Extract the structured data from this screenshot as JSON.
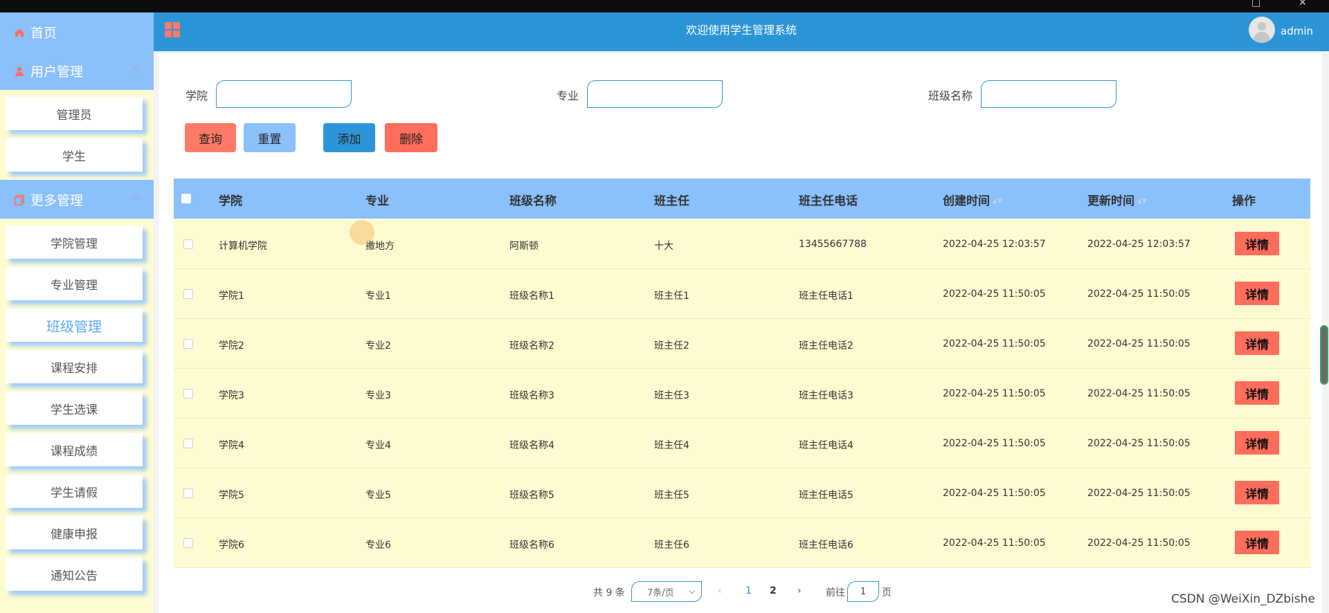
{
  "sidebar": {
    "home_label": "首页",
    "user_mgmt_label": "用户管理",
    "user_items": [
      "管理员",
      "学生"
    ],
    "more_mgmt_label": "更多管理",
    "more_items": [
      "学院管理",
      "专业管理",
      "班级管理",
      "课程安排",
      "学生选课",
      "课程成绩",
      "学生请假",
      "健康申报",
      "通知公告"
    ],
    "active_item": "班级管理"
  },
  "header": {
    "title": "欢迎使用学生管理系统",
    "username": "admin"
  },
  "filters": {
    "college_label": "学院",
    "college_value": "",
    "major_label": "专业",
    "major_value": "",
    "class_label": "班级名称",
    "class_value": ""
  },
  "actions": {
    "search": "查询",
    "reset": "重置",
    "add": "添加",
    "delete": "删除"
  },
  "table": {
    "columns": [
      "学院",
      "专业",
      "班级名称",
      "班主任",
      "班主任电话",
      "创建时间",
      "更新时间",
      "操作"
    ],
    "rows": [
      [
        "计算机学院",
        "撒地方",
        "阿斯顿",
        "十大",
        "13455667788",
        "2022-04-25 12:03:57",
        "2022-04-25 12:03:57"
      ],
      [
        "学院1",
        "专业1",
        "班级名称1",
        "班主任1",
        "班主任电话1",
        "2022-04-25 11:50:05",
        "2022-04-25 11:50:05"
      ],
      [
        "学院2",
        "专业2",
        "班级名称2",
        "班主任2",
        "班主任电话2",
        "2022-04-25 11:50:05",
        "2022-04-25 11:50:05"
      ],
      [
        "学院3",
        "专业3",
        "班级名称3",
        "班主任3",
        "班主任电话3",
        "2022-04-25 11:50:05",
        "2022-04-25 11:50:05"
      ],
      [
        "学院4",
        "专业4",
        "班级名称4",
        "班主任4",
        "班主任电话4",
        "2022-04-25 11:50:05",
        "2022-04-25 11:50:05"
      ],
      [
        "学院5",
        "专业5",
        "班级名称5",
        "班主任5",
        "班主任电话5",
        "2022-04-25 11:50:05",
        "2022-04-25 11:50:05"
      ],
      [
        "学院6",
        "专业6",
        "班级名称6",
        "班主任6",
        "班主任电话6",
        "2022-04-25 11:50:05",
        "2022-04-25 11:50:05"
      ]
    ],
    "detail_label": "详情"
  },
  "pagination": {
    "total": "共 9 条",
    "page_size": "7条/页",
    "prev_icon": "chevron-left-icon",
    "next_icon": "chevron-right-icon",
    "pages": [
      "1",
      "2"
    ],
    "current_page": "1",
    "goto_label": "前往",
    "goto_value": "1",
    "page_suffix": "页"
  },
  "watermark": "CSDN @WeiXin_DZbishe",
  "colors": {
    "sidebar_header": "#8ac0fb",
    "topbar": "#2c95d8",
    "accent_red": "#ff6d5c",
    "row_bg": "#fefbd0"
  }
}
